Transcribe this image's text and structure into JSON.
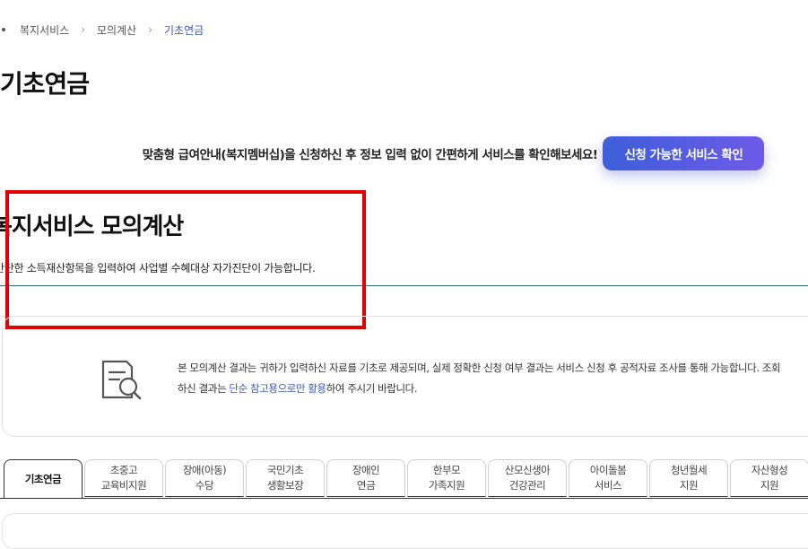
{
  "breadcrumb": {
    "items": [
      "복지서비스",
      "모의계산",
      "기초연금"
    ],
    "separator": "›"
  },
  "page_title": "기초연금",
  "member_banner": {
    "message": "맞춤형 급여안내(복지멤버십)을 신청하신 후 정보 입력 없이 간편하게 서비스를 확인해보세요!",
    "button_label": "신청 가능한 서비스 확인"
  },
  "section": {
    "title": "복지서비스 모의계산",
    "description": "간단한 소득재산항목을 입력하여 사업별 수혜대상 자가진단이 가능합니다."
  },
  "notice": {
    "icon": "document-search-icon",
    "line1": "본 모의계산 결과는 귀하가 입력하신 자료를 기초로 제공되며, 실제 정확한 신청 여부 결과는 서비스 신청 후 공적자료 조사를 통해 가능합니다. 조회",
    "line2_prefix": "하신 결과는 ",
    "line2_highlight": "단순 참고용으로만 활용",
    "line2_suffix": "하여 주시기 바랍니다."
  },
  "tabs": [
    {
      "line1": "기초연금",
      "line2": "",
      "active": true
    },
    {
      "line1": "초중고",
      "line2": "교육비지원",
      "active": false
    },
    {
      "line1": "장애(아동)",
      "line2": "수당",
      "active": false
    },
    {
      "line1": "국민기초",
      "line2": "생활보장",
      "active": false
    },
    {
      "line1": "장애인",
      "line2": "연금",
      "active": false
    },
    {
      "line1": "한부모",
      "line2": "가족지원",
      "active": false
    },
    {
      "line1": "산모신생아",
      "line2": "건강관리",
      "active": false
    },
    {
      "line1": "아이돌봄",
      "line2": "서비스",
      "active": false
    },
    {
      "line1": "청년월세",
      "line2": "지원",
      "active": false
    },
    {
      "line1": "자산형성",
      "line2": "지원",
      "active": false
    }
  ],
  "colors": {
    "accent": "#3a5bbf",
    "button_gradient_start": "#3d5fd9",
    "button_gradient_end": "#6e5ae8",
    "highlight_border": "#e30000",
    "divider": "#2a6f80"
  }
}
